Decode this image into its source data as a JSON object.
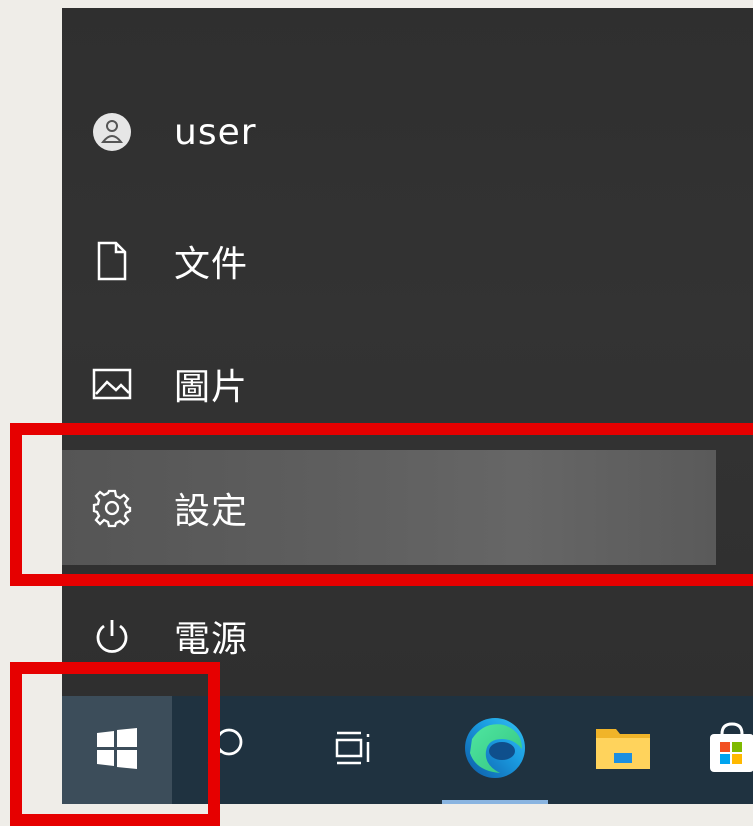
{
  "start_menu": {
    "items": [
      {
        "id": "user",
        "label": "user",
        "icon": "user-icon"
      },
      {
        "id": "documents",
        "label": "文件",
        "icon": "document-icon"
      },
      {
        "id": "pictures",
        "label": "圖片",
        "icon": "picture-icon"
      },
      {
        "id": "settings",
        "label": "設定",
        "icon": "gear-icon"
      },
      {
        "id": "power",
        "label": "電源",
        "icon": "power-icon"
      }
    ]
  },
  "taskbar": {
    "buttons": [
      {
        "id": "start",
        "icon": "windows-logo-icon"
      },
      {
        "id": "search",
        "icon": "search-icon"
      },
      {
        "id": "task-view",
        "icon": "task-view-icon"
      },
      {
        "id": "edge",
        "icon": "edge-icon"
      },
      {
        "id": "file-explorer",
        "icon": "folder-icon"
      },
      {
        "id": "store",
        "icon": "store-icon"
      }
    ]
  },
  "colors": {
    "menu_bg": "#2f2f2f",
    "settings_hover": "#5e5e5e",
    "taskbar_bg": "#1f3240",
    "highlight": "#e60000"
  }
}
